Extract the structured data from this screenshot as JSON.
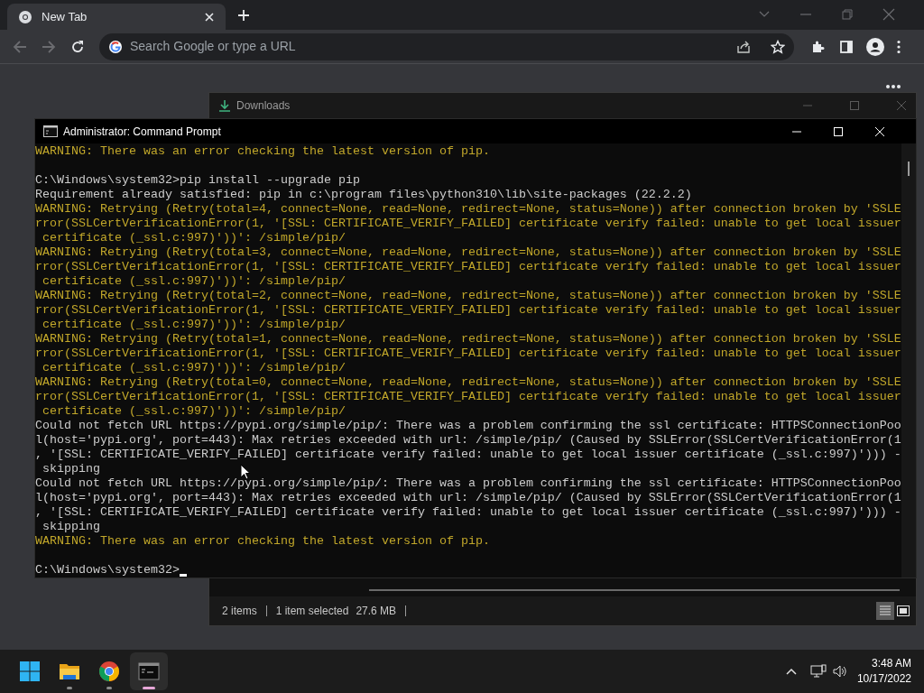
{
  "browser": {
    "tab": {
      "title": "New Tab",
      "selected": true
    },
    "address_bar": {
      "placeholder": "Search Google or type a URL"
    }
  },
  "downloads_window": {
    "title": "Downloads",
    "status_bar": [
      "2 items",
      "1 item selected",
      "27.6 MB"
    ],
    "views": [
      {
        "kind": "details",
        "selected": true
      },
      {
        "kind": "tiles",
        "selected": false
      }
    ]
  },
  "console_window": {
    "title": "Administrator: Command Prompt",
    "lines": [
      {
        "kind": "warning",
        "text": "WARNING: There was an error checking the latest version of pip."
      },
      {
        "kind": "blank"
      },
      {
        "kind": "output",
        "text": "C:\\Windows\\system32>pip install --upgrade pip"
      },
      {
        "kind": "output",
        "text": "Requirement already satisfied: pip in c:\\program files\\python310\\lib\\site-packages (22.2.2)"
      },
      {
        "kind": "warning",
        "text": "WARNING: Retrying (Retry(total=4, connect=None, read=None, redirect=None, status=None)) after connection broken by 'SSLE"
      },
      {
        "kind": "warning",
        "text": "rror(SSLCertVerificationError(1, '[SSL: CERTIFICATE_VERIFY_FAILED] certificate verify failed: unable to get local issuer"
      },
      {
        "kind": "warning",
        "text": " certificate (_ssl.c:997)'))': /simple/pip/"
      },
      {
        "kind": "warning",
        "text": "WARNING: Retrying (Retry(total=3, connect=None, read=None, redirect=None, status=None)) after connection broken by 'SSLE"
      },
      {
        "kind": "warning",
        "text": "rror(SSLCertVerificationError(1, '[SSL: CERTIFICATE_VERIFY_FAILED] certificate verify failed: unable to get local issuer"
      },
      {
        "kind": "warning",
        "text": " certificate (_ssl.c:997)'))': /simple/pip/"
      },
      {
        "kind": "warning",
        "text": "WARNING: Retrying (Retry(total=2, connect=None, read=None, redirect=None, status=None)) after connection broken by 'SSLE"
      },
      {
        "kind": "warning",
        "text": "rror(SSLCertVerificationError(1, '[SSL: CERTIFICATE_VERIFY_FAILED] certificate verify failed: unable to get local issuer"
      },
      {
        "kind": "warning",
        "text": " certificate (_ssl.c:997)'))': /simple/pip/"
      },
      {
        "kind": "warning",
        "text": "WARNING: Retrying (Retry(total=1, connect=None, read=None, redirect=None, status=None)) after connection broken by 'SSLE"
      },
      {
        "kind": "warning",
        "text": "rror(SSLCertVerificationError(1, '[SSL: CERTIFICATE_VERIFY_FAILED] certificate verify failed: unable to get local issuer"
      },
      {
        "kind": "warning",
        "text": " certificate (_ssl.c:997)'))': /simple/pip/"
      },
      {
        "kind": "warning",
        "text": "WARNING: Retrying (Retry(total=0, connect=None, read=None, redirect=None, status=None)) after connection broken by 'SSLE"
      },
      {
        "kind": "warning",
        "text": "rror(SSLCertVerificationError(1, '[SSL: CERTIFICATE_VERIFY_FAILED] certificate verify failed: unable to get local issuer"
      },
      {
        "kind": "warning",
        "text": " certificate (_ssl.c:997)'))': /simple/pip/"
      },
      {
        "kind": "output",
        "text": "Could not fetch URL https://pypi.org/simple/pip/: There was a problem confirming the ssl certificate: HTTPSConnectionPoo"
      },
      {
        "kind": "output",
        "text": "l(host='pypi.org', port=443): Max retries exceeded with url: /simple/pip/ (Caused by SSLError(SSLCertVerificationError(1"
      },
      {
        "kind": "output",
        "text": ", '[SSL: CERTIFICATE_VERIFY_FAILED] certificate verify failed: unable to get local issuer certificate (_ssl.c:997)'))) -"
      },
      {
        "kind": "output",
        "text": " skipping"
      },
      {
        "kind": "output",
        "text": "Could not fetch URL https://pypi.org/simple/pip/: There was a problem confirming the ssl certificate: HTTPSConnectionPoo"
      },
      {
        "kind": "output",
        "text": "l(host='pypi.org', port=443): Max retries exceeded with url: /simple/pip/ (Caused by SSLError(SSLCertVerificationError(1"
      },
      {
        "kind": "output",
        "text": ", '[SSL: CERTIFICATE_VERIFY_FAILED] certificate verify failed: unable to get local issuer certificate (_ssl.c:997)'))) -"
      },
      {
        "kind": "output",
        "text": " skipping"
      },
      {
        "kind": "warning",
        "text": "WARNING: There was an error checking the latest version of pip."
      },
      {
        "kind": "blank"
      },
      {
        "kind": "prompt",
        "text": "C:\\Windows\\system32>"
      }
    ]
  },
  "taskbar": {
    "apps": [
      {
        "kind": "start",
        "running": false,
        "active": false
      },
      {
        "kind": "explorer",
        "running": true,
        "active": false
      },
      {
        "kind": "chrome",
        "running": true,
        "active": false
      },
      {
        "kind": "terminal",
        "running": true,
        "active": true
      }
    ],
    "clock": {
      "time": "3:48 AM",
      "date": "10/17/2022"
    }
  }
}
